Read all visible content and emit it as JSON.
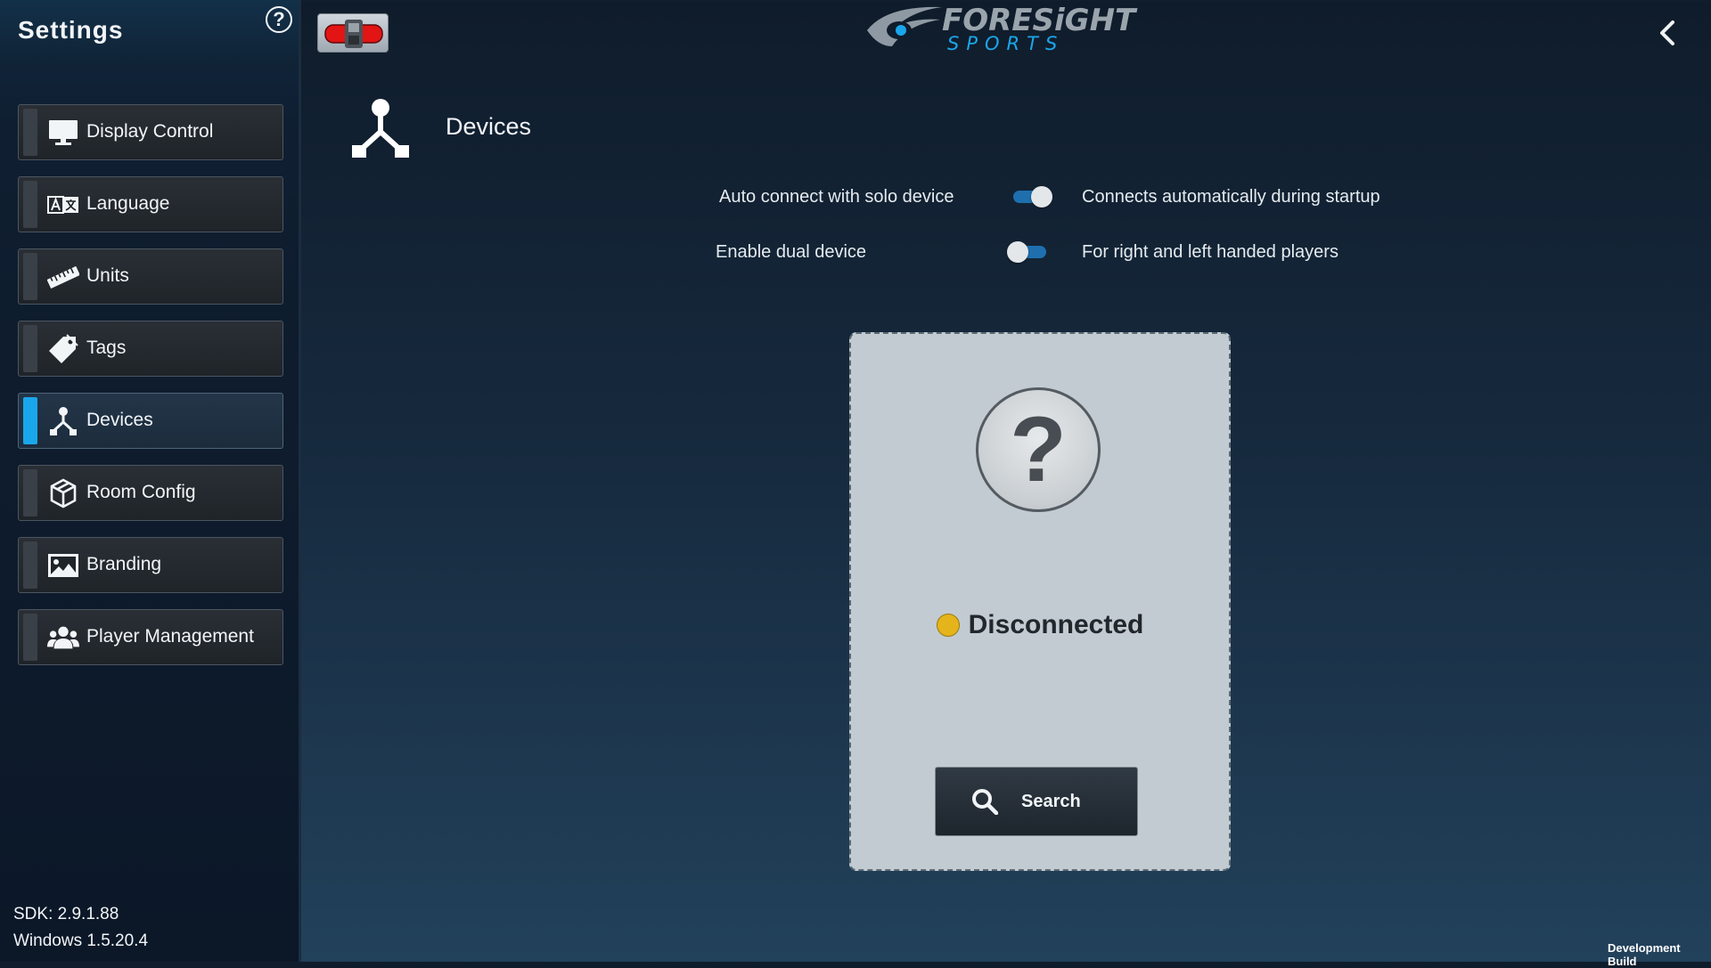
{
  "sidebar": {
    "title": "Settings",
    "help_glyph": "?",
    "items": [
      {
        "label": "Display Control",
        "icon": "monitor-icon",
        "active": false
      },
      {
        "label": "Language",
        "icon": "language-icon",
        "active": false
      },
      {
        "label": "Units",
        "icon": "ruler-icon",
        "active": false
      },
      {
        "label": "Tags",
        "icon": "tag-icon",
        "active": false
      },
      {
        "label": "Devices",
        "icon": "devices-icon",
        "active": true
      },
      {
        "label": "Room Config",
        "icon": "cube-icon",
        "active": false
      },
      {
        "label": "Branding",
        "icon": "image-icon",
        "active": false
      },
      {
        "label": "Player Management",
        "icon": "users-icon",
        "active": false
      }
    ],
    "sdk_version": "SDK: 2.9.1.88",
    "windows_version": "Windows 1.5.20.4"
  },
  "header": {
    "logo_line1": "FORESiGHT",
    "logo_line2": "SPORTS"
  },
  "page": {
    "title": "Devices",
    "options": [
      {
        "label": "Auto connect with solo device",
        "enabled": true,
        "description": "Connects automatically during startup"
      },
      {
        "label": "Enable dual device",
        "enabled": false,
        "description": "For right and left handed players"
      }
    ]
  },
  "device_card": {
    "unknown_glyph": "?",
    "status": "Disconnected",
    "status_color": "#e4b41a",
    "search_label": "Search"
  },
  "footer": {
    "build": "Development Build"
  },
  "colors": {
    "accent": "#1aa6ea",
    "toggle_track": "#1f6fae"
  }
}
